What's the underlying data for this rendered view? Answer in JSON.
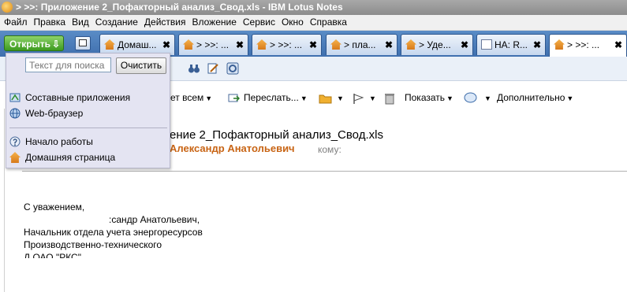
{
  "window": {
    "title": "> >>: Приложение 2_Пофакторный анализ_Свод.xls - IBM Lotus Notes"
  },
  "menu": [
    "Файл",
    "Правка",
    "Вид",
    "Создание",
    "Действия",
    "Вложение",
    "Сервис",
    "Окно",
    "Справка"
  ],
  "open_button": {
    "label": "Открыть",
    "arrow": "⇩"
  },
  "tabs": [
    {
      "label": "Домаш...",
      "icon": "home-icon"
    },
    {
      "label": "> >>: ...",
      "icon": "mail-icon"
    },
    {
      "label": "> >>: ...",
      "icon": "mail-icon"
    },
    {
      "label": "> пла...",
      "icon": "mail-icon"
    },
    {
      "label": "> Уде...",
      "icon": "mail-icon"
    },
    {
      "label": "НА: R...",
      "icon": "mail-icon"
    },
    {
      "label": "> >>: ...",
      "icon": "mail-icon"
    }
  ],
  "tab_close": "✖",
  "actions": {
    "reply_all": "ет всем",
    "forward": "Переслать...",
    "show": "Показать",
    "more": "Дополнительно"
  },
  "open_menu": {
    "search_placeholder": "Текст для поиска",
    "clear_label": "Очистить",
    "items": [
      "Составные приложения",
      "Web-браузер",
      "Начало работы",
      "Домашняя страница"
    ]
  },
  "message": {
    "subject": "ение 2_Пофакторный анализ_Свод.xls",
    "sender": "Александр Анатольевич",
    "to_label": "кому:",
    "body_lines": [
      "С уважением,",
      ":сандр Анатольевич,",
      "Начальник отдела учета энергоресурсов",
      "Производственно-технического",
      "Д                   ОАО \"РКС\""
    ]
  },
  "colors": {
    "tab_strip": "#4a7cba",
    "open_button": "#4ea82a",
    "sender": "#c86414",
    "popup_bg": "#e4e4f2"
  }
}
